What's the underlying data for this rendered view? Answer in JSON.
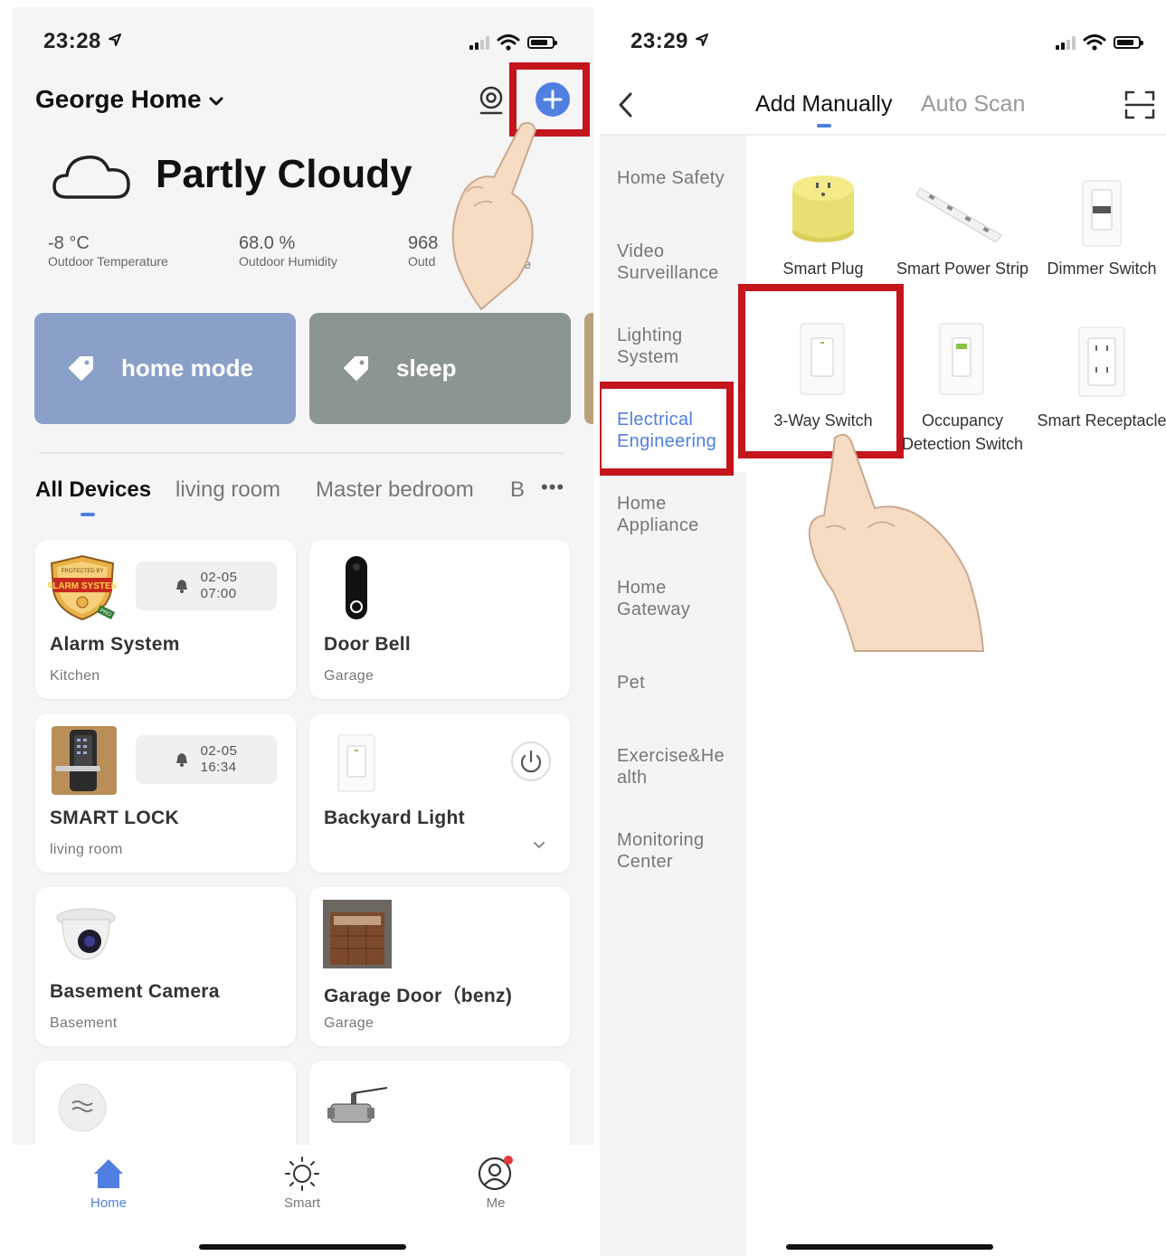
{
  "left": {
    "status_time": "23:28",
    "home_name": "George Home",
    "weather": {
      "condition": "Partly Cloudy",
      "stats": [
        {
          "value": "-8 °C",
          "label": "Outdoor Temperature"
        },
        {
          "value": "68.0 %",
          "label": "Outdoor Humidity"
        },
        {
          "value": "968",
          "label": "Outd",
          "label_end": "essure"
        }
      ]
    },
    "scenes": [
      {
        "label": "home mode",
        "color": "#8aa0c8"
      },
      {
        "label": "sleep",
        "color": "#8c9691"
      }
    ],
    "tabs": [
      "All Devices",
      "living room",
      "Master bedroom",
      "B"
    ],
    "more": "•••",
    "devices": [
      {
        "name": "Alarm System",
        "room": "Kitchen",
        "alarm_date": "02-05",
        "alarm_time": "07:00",
        "badge_top": "PROTECTED BY",
        "badge_mid": "ALARM SYSTEM",
        "badge_pro": "PRO"
      },
      {
        "name": "Door Bell",
        "room": "Garage"
      },
      {
        "name": "SMART LOCK",
        "room": "living room",
        "alarm_date": "02-05",
        "alarm_time": "16:34"
      },
      {
        "name": "Backyard Light",
        "room": ""
      },
      {
        "name": "Basement Camera",
        "room": "Basement"
      },
      {
        "name": "Garage Door（benz)",
        "room": "Garage"
      }
    ],
    "nav": [
      {
        "label": "Home",
        "color": "#4f7fe0"
      },
      {
        "label": "Smart",
        "color": "#777777"
      },
      {
        "label": "Me",
        "color": "#777777"
      }
    ]
  },
  "right": {
    "status_time": "23:29",
    "tabs": [
      "Add Manually",
      "Auto Scan"
    ],
    "categories": [
      "Home Safety",
      "Video Surveillance",
      "Lighting System",
      "Electrical Engineering",
      "Home Appliance",
      "Home Gateway",
      "Pet",
      "Exercise&Health",
      "Monitoring Center"
    ],
    "categories_display": [
      [
        "Home Safety"
      ],
      [
        "Video",
        "Surveillance"
      ],
      [
        "Lighting",
        "System"
      ],
      [
        "Electrical",
        "Engineering"
      ],
      [
        "Home",
        "Appliance"
      ],
      [
        "Home",
        "Gateway"
      ],
      [
        "Pet"
      ],
      [
        "Exercise&He",
        "alth"
      ],
      [
        "Monitoring",
        "Center"
      ]
    ],
    "active_category": "Electrical Engineering",
    "products": [
      {
        "label": "Smart Plug"
      },
      {
        "label": "Smart Power Strip"
      },
      {
        "label": "Dimmer Switch"
      },
      {
        "label": "3-Way Switch"
      },
      {
        "label": "Occupancy Detection Switch"
      },
      {
        "label": "Smart Receptacle"
      }
    ]
  },
  "colors": {
    "accent": "#4f7fe0",
    "highlight": "#c4141c",
    "notification": "#e53935"
  }
}
